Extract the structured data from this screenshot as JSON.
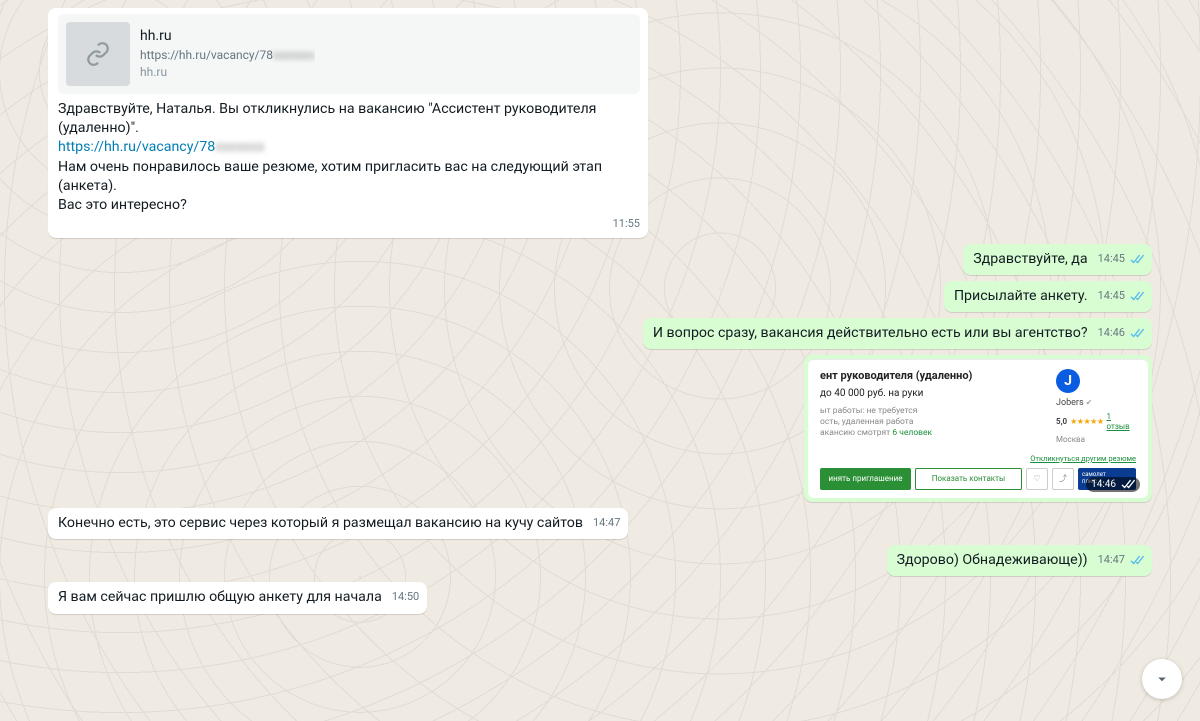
{
  "messages": {
    "m1": {
      "preview": {
        "title": "hh.ru",
        "url_display": "https://hh.ru/vacancy/78",
        "domain": "hh.ru"
      },
      "text_before_link": "Здравствуйте, Наталья. Вы откликнулись на вакансию \"Ассистент руководителя (удаленно)\".",
      "link_text": "https://hh.ru/vacancy/78",
      "text_after_link": "Нам очень понравилось ваше резюме, хотим пригласить вас на следующий этап (анкета).\nВас это интересно?",
      "time": "11:55"
    },
    "m2": {
      "text": "Здравствуйте, да",
      "time": "14:45"
    },
    "m3": {
      "text": "Присылайте анкету.",
      "time": "14:45"
    },
    "m4": {
      "text": "И вопрос сразу, вакансия действительно есть или вы агентство?",
      "time": "14:46"
    },
    "m5": {
      "img": {
        "title_fragment": "ент руководителя (удаленно)",
        "salary": "до 40 000 руб. на руки",
        "line1": "ыт работы: не требуется",
        "line2": "ость, удаленная работа",
        "line3_prefix": "акансию смотрят ",
        "line3_count": "6 человек",
        "other_resume": "Откликнуться другим резюме",
        "btn_invite": "инять приглашение",
        "btn_contacts": "Показать контакты",
        "company": "Jobers",
        "rating_value": "5,0",
        "reviews": "1 отзыв",
        "city": "Москва",
        "promo_top": "самолет",
        "promo_bottom": "плюс"
      },
      "time": "14:46"
    },
    "m6": {
      "text": "Конечно есть, это сервис через который я размещал вакансию на кучу сайтов",
      "time": "14:47"
    },
    "m7": {
      "text": "Здорово) Обнадеживающе))",
      "time": "14:47"
    },
    "m8": {
      "text": "Я вам сейчас пришлю общую анкету для начала",
      "time": "14:50"
    }
  }
}
